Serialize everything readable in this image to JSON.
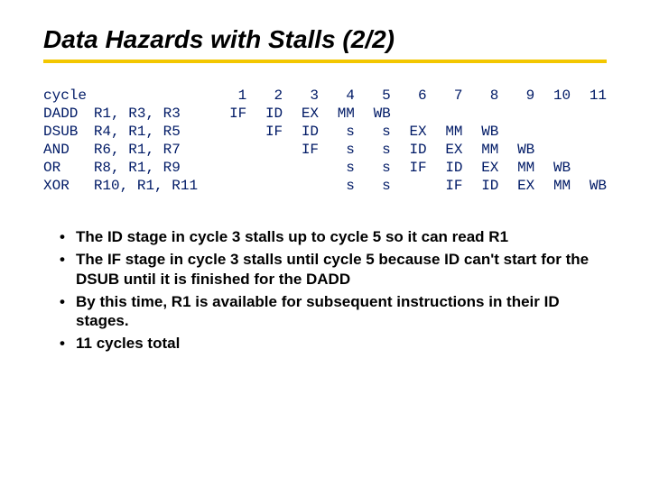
{
  "title": "Data Hazards with Stalls (2/2)",
  "color_accent": "#f3c700",
  "color_mono": "#001a66",
  "chart_data": {
    "type": "table",
    "title": "Pipeline stage diagram with stalls",
    "cycle_header": "cycle",
    "cycles": [
      "1",
      "2",
      "3",
      "4",
      "5",
      "6",
      "7",
      "8",
      "9",
      "10",
      "11"
    ],
    "instructions": [
      {
        "op": "DADD",
        "args": "R1, R3, R3",
        "stages": [
          "IF",
          "ID",
          "EX",
          "MM",
          "WB",
          "",
          "",
          "",
          "",
          "",
          ""
        ]
      },
      {
        "op": "DSUB",
        "args": "R4, R1, R5",
        "stages": [
          "",
          "IF",
          "ID",
          "s",
          "s",
          "EX",
          "MM",
          "WB",
          "",
          "",
          ""
        ]
      },
      {
        "op": "AND",
        "args": "R6, R1, R7",
        "stages": [
          "",
          "",
          "IF",
          "s",
          "s",
          "ID",
          "EX",
          "MM",
          "WB",
          "",
          ""
        ]
      },
      {
        "op": "OR",
        "args": "R8, R1, R9",
        "stages": [
          "",
          "",
          "",
          "s",
          "s",
          "IF",
          "ID",
          "EX",
          "MM",
          "WB",
          ""
        ]
      },
      {
        "op": "XOR",
        "args": "R10, R1, R11",
        "stages": [
          "",
          "",
          "",
          "s",
          "s",
          "",
          "IF",
          "ID",
          "EX",
          "MM",
          "WB"
        ]
      }
    ]
  },
  "bullets": [
    "The ID stage in cycle 3 stalls up to cycle 5 so it can read R1",
    "The IF stage in cycle 3 stalls until cycle 5 because ID can't start for the DSUB until it is finished for the DADD",
    "By this time, R1 is available for subsequent instructions in their ID stages.",
    "11 cycles total"
  ]
}
